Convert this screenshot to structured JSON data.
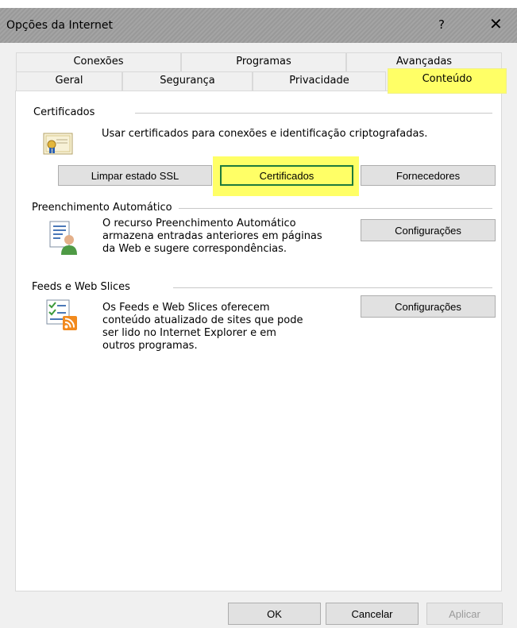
{
  "window": {
    "title": "Opções da Internet",
    "help_glyph": "?",
    "close_glyph": "✕"
  },
  "tabs_row1": [
    {
      "label": "Conexões"
    },
    {
      "label": "Programas"
    },
    {
      "label": "Avançadas"
    }
  ],
  "tabs_row2": [
    {
      "label": "Geral"
    },
    {
      "label": "Segurança"
    },
    {
      "label": "Privacidade"
    },
    {
      "label": "Conteúdo",
      "active": true
    }
  ],
  "certificates": {
    "group_label": "Certificados",
    "description": "Usar certificados para conexões e identificação criptografadas.",
    "icon": "certificate-icon",
    "buttons": {
      "clear_ssl": "Limpar estado SSL",
      "certificates": "Certificados",
      "publishers": "Fornecedores"
    }
  },
  "autocomplete": {
    "group_label": "Preenchimento Automático",
    "icon": "autocomplete-icon",
    "description_lines": [
      "O recurso Preenchimento Automático",
      "armazena entradas anteriores em páginas",
      "da Web e sugere correspondências."
    ],
    "settings_button": "Configurações"
  },
  "feeds": {
    "group_label": "Feeds e Web Slices",
    "icon": "feeds-icon",
    "description_lines": [
      "Os Feeds e Web Slices oferecem",
      "conteúdo atualizado de sites que pode",
      "ser lido no Internet Explorer e em",
      "outros programas."
    ],
    "settings_button": "Configurações"
  },
  "footer": {
    "ok": "OK",
    "cancel": "Cancelar",
    "apply": "Aplicar"
  },
  "colors": {
    "highlight": "#ffff66",
    "focus_border": "#1e7a3c"
  }
}
